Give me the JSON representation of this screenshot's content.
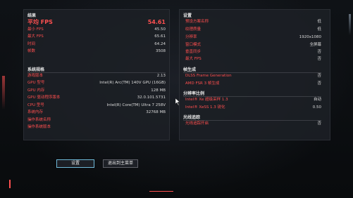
{
  "results": {
    "title": "结果",
    "avg_fps_label": "平均 FPS",
    "avg_fps_value": "54.61",
    "rows": [
      {
        "label": "最小 FPS",
        "value": "45.50"
      },
      {
        "label": "最大 FPS",
        "value": "65.61"
      },
      {
        "label": "时间",
        "value": "64.24"
      },
      {
        "label": "帧数",
        "value": "3508"
      }
    ]
  },
  "system": {
    "title": "系统规格",
    "rows": [
      {
        "label": "游戏版本",
        "value": "2.13"
      },
      {
        "label": "GPU 型号",
        "value": "Intel(R) Arc(TM) 140V GPU (16GB)"
      },
      {
        "label": "GPU 内存",
        "value": "128 MB"
      },
      {
        "label": "GPU 驱动程序版本",
        "value": "32.0.101.5731"
      },
      {
        "label": "CPU 型号",
        "value": "Intel(R) Core(TM) Ultra 7 258V"
      },
      {
        "label": "系统内存",
        "value": "32768 MB"
      },
      {
        "label": "操作系统名称",
        "value": ""
      },
      {
        "label": "操作系统版本",
        "value": ""
      }
    ]
  },
  "settings": {
    "title": "设置",
    "rows": [
      {
        "label": "预设方案名称",
        "value": "低"
      },
      {
        "label": "纹理质量",
        "value": "低"
      },
      {
        "label": "分辨率",
        "value": "1920x1080"
      },
      {
        "label": "窗口模式",
        "value": "全屏幕"
      },
      {
        "label": "垂直同步",
        "value": "否"
      },
      {
        "label": "最大 FPS",
        "value": "否"
      }
    ]
  },
  "framegen": {
    "title": "帧生成",
    "rows": [
      {
        "label": "DLSS Frame Generation",
        "value": "否"
      },
      {
        "label": "AMD FSR 3 帧生成",
        "value": "否"
      }
    ]
  },
  "resolution_scaling": {
    "title": "分辨率比例",
    "rows": [
      {
        "label": "Intel® Xe 超级采样 1.3",
        "value": "自动"
      },
      {
        "label": "Intel® XeSS 1.3 锐化",
        "value": "0.50"
      }
    ]
  },
  "raytracing": {
    "title": "光线追踪",
    "rows": [
      {
        "label": "光线追踪开启",
        "value": "否"
      }
    ]
  },
  "buttons": {
    "settings": "设置",
    "exit": "退出到主菜单"
  },
  "colors": {
    "accent_red": "#ff4f4f",
    "accent_cyan": "#6fb9d8",
    "panel_bg": "#1c2026"
  }
}
